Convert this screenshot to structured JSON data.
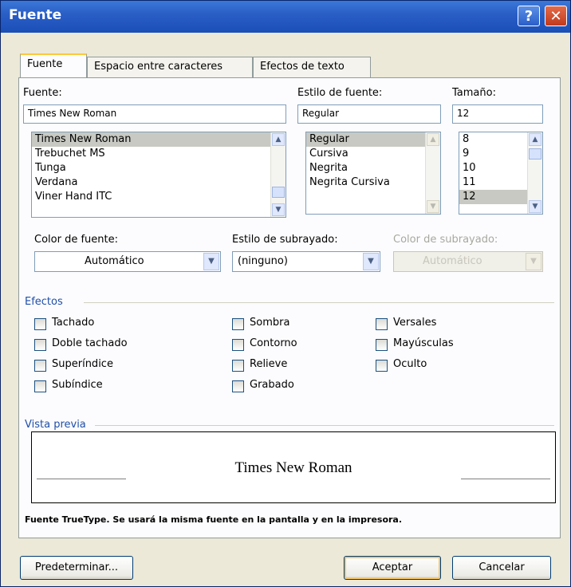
{
  "window": {
    "title": "Fuente"
  },
  "tabs": [
    {
      "label": "Fuente"
    },
    {
      "label": "Espacio entre caracteres"
    },
    {
      "label": "Efectos de texto"
    }
  ],
  "font": {
    "label": "Fuente:",
    "value": "Times New Roman",
    "items": [
      "Times New Roman",
      "Trebuchet MS",
      "Tunga",
      "Verdana",
      "Viner Hand ITC"
    ],
    "selected_index": 0
  },
  "style": {
    "label": "Estilo de fuente:",
    "value": "Regular",
    "items": [
      "Regular",
      "Cursiva",
      "Negrita",
      "Negrita Cursiva"
    ],
    "selected_index": 0
  },
  "size": {
    "label": "Tamaño:",
    "value": "12",
    "items": [
      "8",
      "9",
      "10",
      "11",
      "12"
    ],
    "selected_index": 4
  },
  "font_color": {
    "label": "Color de fuente:",
    "value": "Automático"
  },
  "underline_style": {
    "label": "Estilo de subrayado:",
    "value": "(ninguno)"
  },
  "underline_color": {
    "label": "Color de subrayado:",
    "value": "Automático"
  },
  "effects": {
    "label": "Efectos",
    "col1": [
      "Tachado",
      "Doble tachado",
      "Superíndice",
      "Subíndice"
    ],
    "col2": [
      "Sombra",
      "Contorno",
      "Relieve",
      "Grabado"
    ],
    "col3": [
      "Versales",
      "Mayúsculas",
      "Oculto"
    ]
  },
  "preview": {
    "label": "Vista previa",
    "text": "Times New Roman"
  },
  "info": "Fuente TrueType. Se usará la misma fuente en la pantalla y en la impresora.",
  "buttons": {
    "default": "Predeterminar...",
    "ok": "Aceptar",
    "cancel": "Cancelar"
  },
  "colors": {
    "titlebar": "#2a5fc6",
    "dialog_bg": "#ece9d8",
    "tab_highlight": "#ffc83c"
  }
}
